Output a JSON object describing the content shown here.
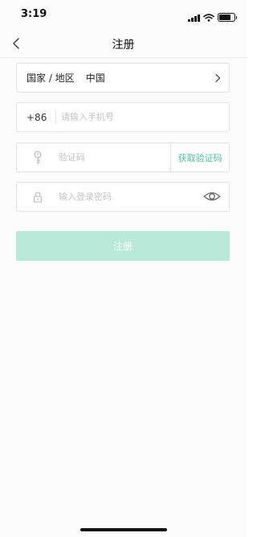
{
  "status_bar": {
    "time": "3:19"
  },
  "nav": {
    "title": "注册"
  },
  "region": {
    "label": "国家 / 地区",
    "value": "中国"
  },
  "phone": {
    "country_code": "+86",
    "placeholder": "请输入手机号"
  },
  "verification": {
    "placeholder": "验证码",
    "get_code_label": "获取验证码"
  },
  "password": {
    "placeholder": "输入登录密码"
  },
  "submit": {
    "label": "注册"
  },
  "colors": {
    "accent": "#4fbf97",
    "button_disabled": "#b9e9d8",
    "border": "#e3e3e3"
  },
  "icons": [
    "wifi-icon",
    "battery-icon",
    "signal-icon",
    "back-chevron-icon",
    "chevron-right-icon",
    "key-icon",
    "lock-icon",
    "eye-icon"
  ]
}
